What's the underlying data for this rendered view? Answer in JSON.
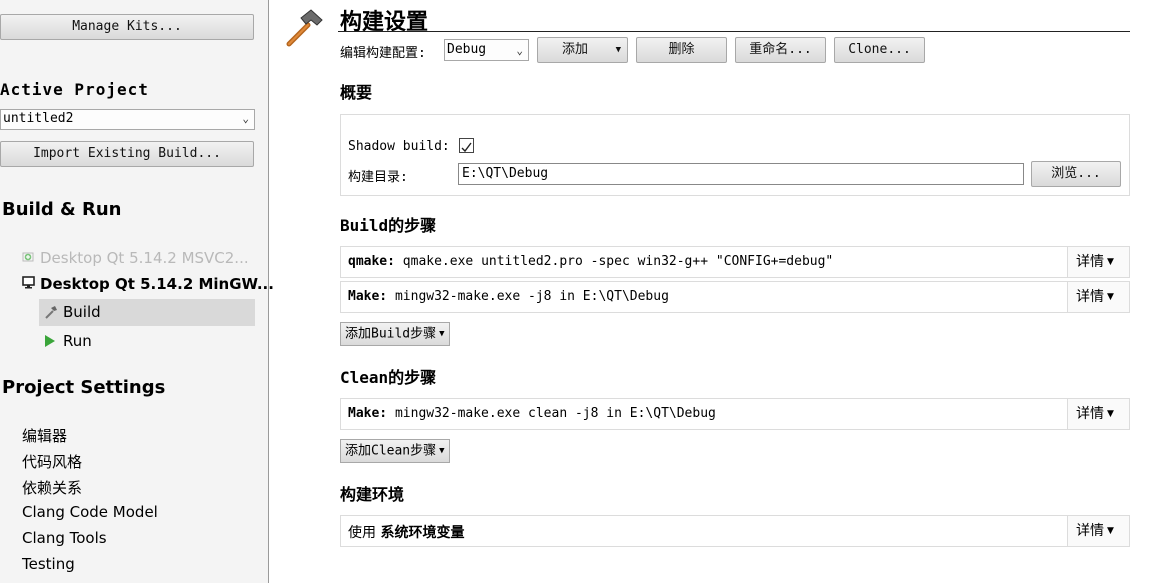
{
  "sidebar": {
    "manage_kits": "Manage Kits...",
    "active_project_heading": "Active Project",
    "project_select": "untitled2",
    "import_build": "Import Existing Build...",
    "build_run_heading": "Build & Run",
    "kits": [
      {
        "label": "Desktop Qt 5.14.2 MSVC2...",
        "icon": "add-kit-icon"
      },
      {
        "label": "Desktop Qt 5.14.2 MinGW...",
        "icon": "monitor-icon"
      }
    ],
    "build_item": "Build",
    "run_item": "Run",
    "project_settings_heading": "Project Settings",
    "settings_items": [
      "编辑器",
      "代码风格",
      "依赖关系",
      "Clang Code Model",
      "Clang Tools",
      "Testing"
    ]
  },
  "main": {
    "title": "构建设置",
    "edit_config_label": "编辑构建配置:",
    "config_select": "Debug",
    "add_button": "添加",
    "delete_button": "删除",
    "rename_button": "重命名...",
    "clone_button": "Clone...",
    "overview_heading": "概要",
    "shadow_build_label": "Shadow build:",
    "shadow_build_checked": true,
    "build_dir_label": "构建目录:",
    "build_dir_value": "E:\\QT\\Debug",
    "browse_button": "浏览...",
    "build_steps_heading": "Build的步骤",
    "build_steps": [
      {
        "name": "qmake:",
        "cmd": "qmake.exe untitled2.pro -spec win32-g++ \"CONFIG+=debug\"",
        "details": "详情"
      },
      {
        "name": "Make:",
        "cmd": "mingw32-make.exe -j8 in E:\\QT\\Debug",
        "details": "详情"
      }
    ],
    "add_build_step": "添加Build步骤",
    "clean_steps_heading": "Clean的步骤",
    "clean_steps": [
      {
        "name": "Make:",
        "cmd": "mingw32-make.exe clean -j8 in E:\\QT\\Debug",
        "details": "详情"
      }
    ],
    "add_clean_step": "添加Clean步骤",
    "build_env_heading": "构建环境",
    "env_prefix": "使用",
    "env_value": "系统环境变量",
    "env_details": "详情"
  },
  "colors": {
    "sidebar_bg": "#f4f4f4",
    "selected_bg": "#d9d9d9",
    "run_green": "#3aa53a"
  }
}
